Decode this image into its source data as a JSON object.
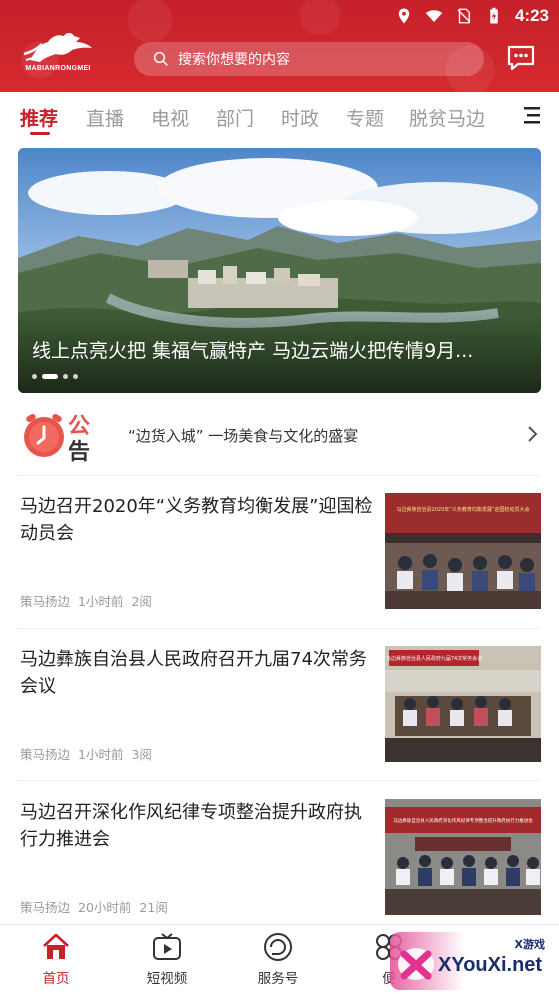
{
  "status_bar": {
    "time": "4:23",
    "icons": [
      "location-icon",
      "wifi-icon",
      "sim-off-icon",
      "battery-charging-icon"
    ]
  },
  "header": {
    "logo_text": "MABIANRONGMEI",
    "search_placeholder": "搜索你想要的内容",
    "message_icon": "chat-icon",
    "brand_color": "#c6202a"
  },
  "tabs": [
    {
      "label": "推荐",
      "active": true
    },
    {
      "label": "直播",
      "active": false
    },
    {
      "label": "电视",
      "active": false
    },
    {
      "label": "部门",
      "active": false
    },
    {
      "label": "时政",
      "active": false
    },
    {
      "label": "专题",
      "active": false
    },
    {
      "label": "脱贫马边",
      "active": false
    }
  ],
  "banner": {
    "title": "线上点亮火把 集福气赢特产 马边云端火把传情9月...",
    "slide_count": 4,
    "active_slide": 2
  },
  "notice": {
    "icon_label": "公告",
    "text": "“边货入城” 一场美食与文化的盛宴"
  },
  "news": [
    {
      "title": "马边召开2020年“义务教育均衡发展”迎国检动员会",
      "source": "策马扬边",
      "time": "1小时前",
      "reads": "2阅",
      "banner_text": "马边彝族自治县2020年“义务教育均衡发展”迎国检动员大会"
    },
    {
      "title": "马边彝族自治县人民政府召开九届74次常务会议",
      "source": "策马扬边",
      "time": "1小时前",
      "reads": "3阅",
      "banner_text": "马边彝族自治县人民政府九届74次常务会议"
    },
    {
      "title": "马边召开深化作风纪律专项整治提升政府执行力推进会",
      "source": "策马扬边",
      "time": "20小时前",
      "reads": "21阅",
      "banner_text": "马边彝族自治县人民政府深化作风纪律专项整治提升政府执行力推进会"
    }
  ],
  "bottom_nav": [
    {
      "label": "首页",
      "icon": "home-icon",
      "active": true
    },
    {
      "label": "短视频",
      "icon": "video-icon",
      "active": false
    },
    {
      "label": "服务号",
      "icon": "service-icon",
      "active": false
    },
    {
      "label": "便",
      "icon": "convenience-icon",
      "active": false
    }
  ],
  "watermark": {
    "site": "XYouXi.net",
    "tag": "X游戏"
  }
}
